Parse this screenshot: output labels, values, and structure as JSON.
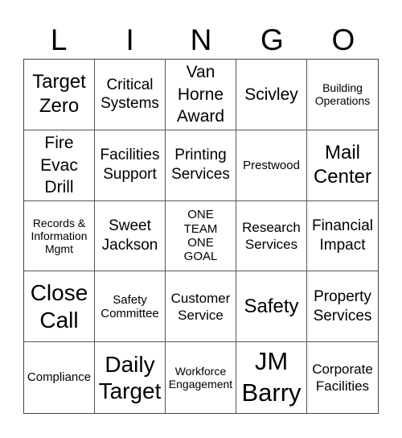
{
  "header": {
    "letters": [
      "L",
      "I",
      "N",
      "G",
      "O"
    ]
  },
  "cells": [
    "Target\nZero",
    "Critical\nSystems",
    "Van\nHorne\nAward",
    "Scivley",
    "Building\nOperations",
    "Fire\nEvac\nDrill",
    "Facilities\nSupport",
    "Printing\nServices",
    "Prestwood",
    "Mail\nCenter",
    "Records &\nInformation\nMgmt",
    "Sweet\nJackson",
    "ONE\nTEAM\nONE\nGOAL",
    "Research\nServices",
    "Financial\nImpact",
    "Close\nCall",
    "Safety\nCommittee",
    "Customer\nService",
    "Safety",
    "Property\nServices",
    "Compliance",
    "Daily\nTarget",
    "Workforce\nEngagement",
    "JM\nBarry",
    "Corporate\nFacilities"
  ]
}
